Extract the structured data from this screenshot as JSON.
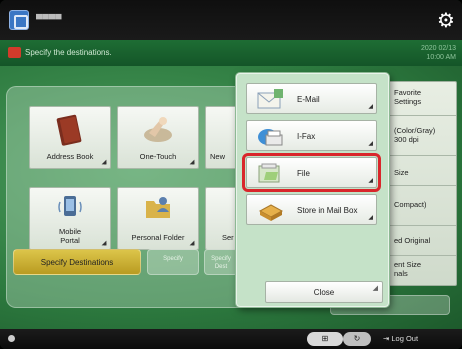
{
  "topbar": {
    "user_label": "▀▀▀▀",
    "settings_icon": "gear-icon"
  },
  "message": {
    "text": "Specify the destinations.",
    "datetime": "2020 02/13\n10:00 AM"
  },
  "destination_tiles": [
    {
      "label": "Address Book",
      "icon": "address-book-icon"
    },
    {
      "label": "One-Touch",
      "icon": "one-touch-icon"
    },
    {
      "label": "New",
      "icon": "new-destination-icon"
    },
    {
      "label": "Mobile\nPortal",
      "icon": "mobile-portal-icon"
    },
    {
      "label": "Personal Folder",
      "icon": "personal-folder-icon"
    },
    {
      "label": "Ser",
      "icon": "server-icon"
    }
  ],
  "bottom_actions": {
    "specify_destinations": "Specify Destinations",
    "ghost1": "Specify",
    "ghost2": "Specify\nDest"
  },
  "right_panel": {
    "items": [
      {
        "label": "Favorite\nSettings"
      },
      {
        "label": "(Color/Gray)\n300 dpi"
      },
      {
        "label": "Size"
      },
      {
        "label": "Compact)"
      },
      {
        "label": "ed Original"
      },
      {
        "label": "ent Size\nnals"
      }
    ]
  },
  "popup": {
    "items": [
      {
        "label": "E-Mail",
        "icon": "email-icon"
      },
      {
        "label": "I-Fax",
        "icon": "ifax-icon"
      },
      {
        "label": "File",
        "icon": "file-icon",
        "selected": true
      },
      {
        "label": "Store in Mail Box",
        "icon": "mailbox-icon"
      }
    ],
    "close_label": "Close"
  },
  "bottombar": {
    "logout_label": "Log Out"
  },
  "colors": {
    "selection_outline": "#d9262b",
    "accent_yellow": "#c9ad2e",
    "green_bg": "#2d7a3f"
  }
}
